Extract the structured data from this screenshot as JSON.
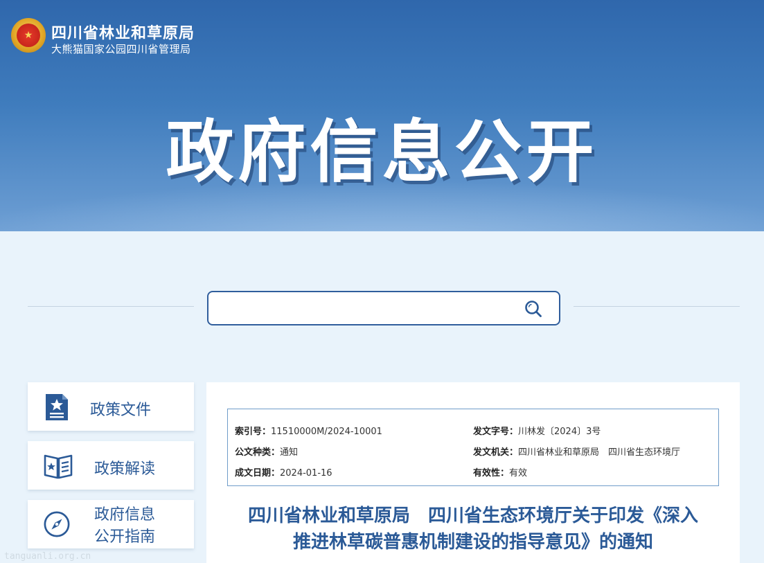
{
  "header": {
    "org_name": "四川省林业和草原局",
    "org_sub": "大熊猫国家公园四川省管理局",
    "hero_title": "政府信息公开"
  },
  "search": {
    "placeholder": "",
    "value": ""
  },
  "sidebar": {
    "items": [
      {
        "label": "政策文件",
        "icon": "document-star-icon"
      },
      {
        "label": "政策解读",
        "icon": "open-book-icon"
      },
      {
        "label_line1": "政府信息",
        "label_line2": "公开指南",
        "icon": "compass-icon"
      }
    ]
  },
  "document": {
    "meta": {
      "index_label": "索引号：",
      "index_value": "11510000M/2024-10001",
      "docno_label": "发文字号：",
      "docno_value": "川林发〔2024〕3号",
      "type_label": "公文种类：",
      "type_value": "通知",
      "issuer_label": "发文机关：",
      "issuer_value": "四川省林业和草原局　四川省生态环境厅",
      "date_label": "成文日期：",
      "date_value": "2024-01-16",
      "validity_label": "有效性：",
      "validity_value": "有效"
    },
    "title_line1": "四川省林业和草原局　四川省生态环境厅关于印发《深入",
    "title_line2": "推进林草碳普惠机制建设的指导意见》的通知"
  },
  "watermark": "tanguanli.org.cn",
  "colors": {
    "banner_top": "#2f67ac",
    "accent_blue": "#2b5a97",
    "page_bg": "#e9f3fb"
  }
}
